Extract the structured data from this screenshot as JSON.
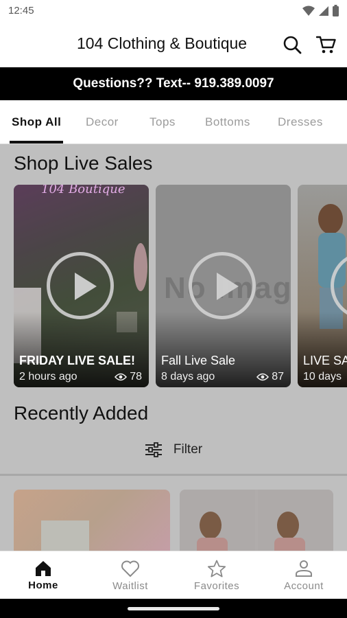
{
  "status_bar": {
    "time": "12:45"
  },
  "header": {
    "title": "104 Clothing & Boutique"
  },
  "banner": {
    "text": "Questions?? Text-- 919.389.0097"
  },
  "tabs": [
    {
      "label": "Shop All",
      "active": true
    },
    {
      "label": "Decor",
      "active": false
    },
    {
      "label": "Tops",
      "active": false
    },
    {
      "label": "Bottoms",
      "active": false
    },
    {
      "label": "Dresses",
      "active": false
    }
  ],
  "live_sales": {
    "title": "Shop Live Sales",
    "cards": [
      {
        "title": "FRIDAY LIVE SALE!",
        "time": "2 hours ago",
        "views": "78",
        "thumb_text": "104 Boutique"
      },
      {
        "title": "Fall Live Sale",
        "time": "8 days ago",
        "views": "87",
        "placeholder_text": "No Image"
      },
      {
        "title": "LIVE SA",
        "time": "10 days"
      }
    ]
  },
  "recent": {
    "title": "Recently Added",
    "filter_label": "Filter"
  },
  "bottom_nav": [
    {
      "label": "Home",
      "icon": "home-icon",
      "active": true
    },
    {
      "label": "Waitlist",
      "icon": "heart-icon",
      "active": false
    },
    {
      "label": "Favorites",
      "icon": "star-icon",
      "active": false
    },
    {
      "label": "Account",
      "icon": "account-icon",
      "active": false
    }
  ]
}
